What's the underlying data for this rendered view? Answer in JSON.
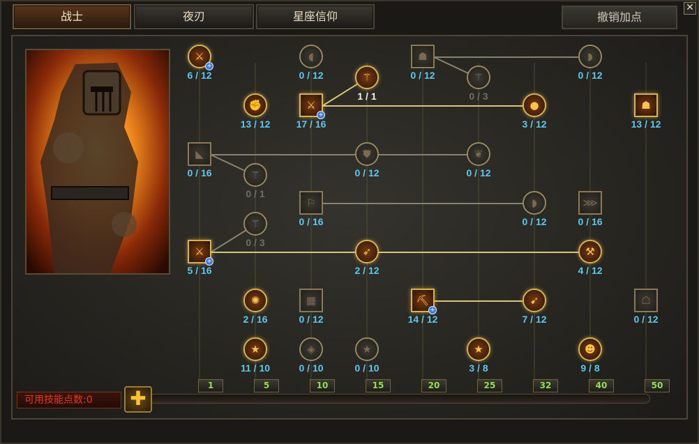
{
  "tabs": [
    {
      "label": "战士",
      "active": true
    },
    {
      "label": "夜刃",
      "active": false
    },
    {
      "label": "星座信仰",
      "active": false
    }
  ],
  "reset_label": "撤销加点",
  "close_label": "✕",
  "available_points_label": "可用技能点数:0",
  "add_button_label": "✚",
  "level_markers": [
    "1",
    "5",
    "10",
    "15",
    "20",
    "25",
    "32",
    "40",
    "50"
  ],
  "skills": [
    {
      "id": "s1",
      "count": "6 / 12",
      "style": "blue",
      "shape": "round",
      "lit": true,
      "plus": true,
      "icon": "blade-icon"
    },
    {
      "id": "s2",
      "count": "0 / 12",
      "style": "blue",
      "shape": "round",
      "lit": false,
      "plus": false,
      "icon": "shield-icon"
    },
    {
      "id": "s3",
      "count": "0 / 12",
      "style": "blue",
      "shape": "square",
      "lit": false,
      "plus": false,
      "icon": "warrior-icon"
    },
    {
      "id": "s4",
      "count": "0 / 12",
      "style": "blue",
      "shape": "round",
      "lit": false,
      "plus": false,
      "icon": "slash-icon"
    },
    {
      "id": "s5",
      "count": "1 / 1",
      "style": "white",
      "shape": "round",
      "lit": true,
      "plus": false,
      "icon": "rune-icon"
    },
    {
      "id": "s6",
      "count": "0 / 3",
      "style": "dim",
      "shape": "round",
      "lit": false,
      "plus": false,
      "icon": "rune-icon"
    },
    {
      "id": "s7",
      "count": "13 / 12",
      "style": "blue",
      "shape": "round",
      "lit": true,
      "plus": false,
      "icon": "fist-icon"
    },
    {
      "id": "s8",
      "count": "17 / 16",
      "style": "blue",
      "shape": "square",
      "lit": true,
      "plus": true,
      "icon": "sword-icon"
    },
    {
      "id": "s9",
      "count": "3 / 12",
      "style": "blue",
      "shape": "round",
      "lit": true,
      "plus": false,
      "icon": "fire-icon"
    },
    {
      "id": "s10",
      "count": "13 / 12",
      "style": "blue",
      "shape": "square",
      "lit": true,
      "plus": false,
      "icon": "helm-icon"
    },
    {
      "id": "s11",
      "count": "0 / 16",
      "style": "blue",
      "shape": "square",
      "lit": false,
      "plus": false,
      "icon": "strike-icon"
    },
    {
      "id": "s12",
      "count": "0 / 12",
      "style": "blue",
      "shape": "round",
      "lit": false,
      "plus": false,
      "icon": "armor-icon"
    },
    {
      "id": "s13",
      "count": "0 / 12",
      "style": "blue",
      "shape": "round",
      "lit": false,
      "plus": false,
      "icon": "wing-icon"
    },
    {
      "id": "s14",
      "count": "0 / 1",
      "style": "dim",
      "shape": "round",
      "lit": false,
      "plus": false,
      "icon": "rune-icon"
    },
    {
      "id": "s15",
      "count": "0 / 16",
      "style": "blue",
      "shape": "square",
      "lit": false,
      "plus": false,
      "icon": "runner-icon"
    },
    {
      "id": "s16",
      "count": "0 / 12",
      "style": "blue",
      "shape": "round",
      "lit": false,
      "plus": false,
      "icon": "boot-icon"
    },
    {
      "id": "s17",
      "count": "0 / 16",
      "style": "blue",
      "shape": "square",
      "lit": false,
      "plus": false,
      "icon": "claw-icon"
    },
    {
      "id": "s18",
      "count": "0 / 3",
      "style": "dim",
      "shape": "round",
      "lit": false,
      "plus": false,
      "icon": "rune-icon"
    },
    {
      "id": "s19",
      "count": "5 / 16",
      "style": "blue",
      "shape": "square",
      "lit": true,
      "plus": true,
      "icon": "dual-blade-icon"
    },
    {
      "id": "s20",
      "count": "2 / 12",
      "style": "blue",
      "shape": "round",
      "lit": true,
      "plus": false,
      "icon": "charge-icon"
    },
    {
      "id": "s21",
      "count": "4 / 12",
      "style": "blue",
      "shape": "round",
      "lit": true,
      "plus": false,
      "icon": "axe-icon"
    },
    {
      "id": "s22",
      "count": "2 / 16",
      "style": "blue",
      "shape": "round",
      "lit": true,
      "plus": false,
      "icon": "aura-icon"
    },
    {
      "id": "s23",
      "count": "0 / 12",
      "style": "blue",
      "shape": "square",
      "lit": false,
      "plus": false,
      "icon": "gauntlet-icon"
    },
    {
      "id": "s24",
      "count": "14 / 12",
      "style": "blue",
      "shape": "square",
      "lit": true,
      "plus": true,
      "icon": "cannon-icon"
    },
    {
      "id": "s25",
      "count": "7 / 12",
      "style": "blue",
      "shape": "round",
      "lit": true,
      "plus": false,
      "icon": "spin-icon"
    },
    {
      "id": "s26",
      "count": "0 / 12",
      "style": "blue",
      "shape": "square",
      "lit": false,
      "plus": false,
      "icon": "cloak-icon"
    },
    {
      "id": "s27",
      "count": "11 / 10",
      "style": "blue",
      "shape": "round",
      "lit": true,
      "plus": false,
      "icon": "star-icon"
    },
    {
      "id": "s28",
      "count": "0 / 10",
      "style": "blue",
      "shape": "round",
      "lit": false,
      "plus": false,
      "icon": "pendant-icon"
    },
    {
      "id": "s29",
      "count": "0 / 10",
      "style": "blue",
      "shape": "round",
      "lit": false,
      "plus": false,
      "icon": "star-icon"
    },
    {
      "id": "s30",
      "count": "3 / 8",
      "style": "blue",
      "shape": "round",
      "lit": true,
      "plus": false,
      "icon": "star-icon"
    },
    {
      "id": "s31",
      "count": "9 / 8",
      "style": "blue",
      "shape": "round",
      "lit": true,
      "plus": false,
      "icon": "face-icon"
    }
  ]
}
